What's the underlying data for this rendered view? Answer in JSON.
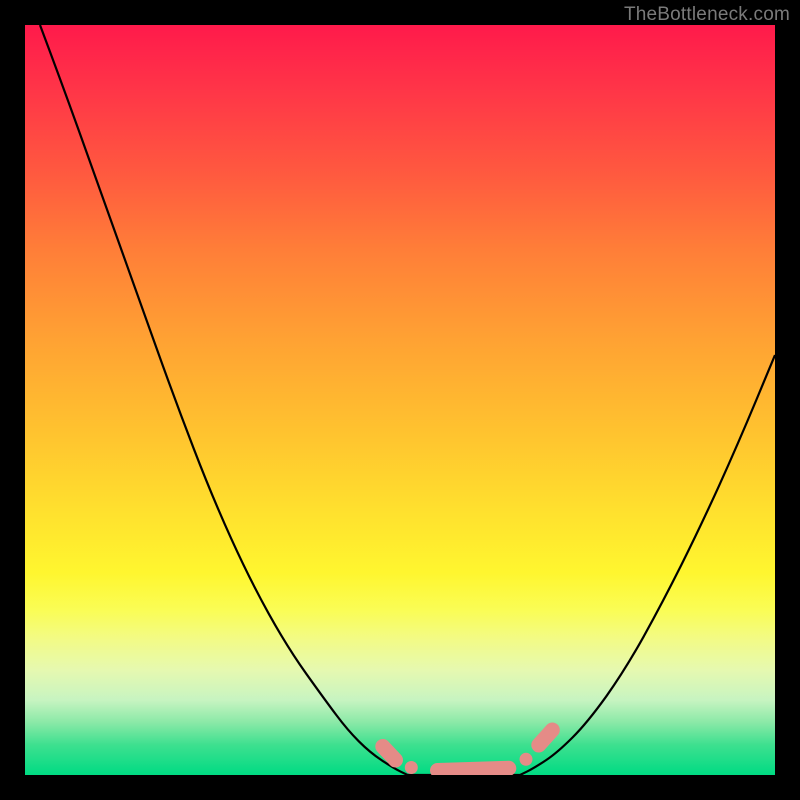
{
  "watermark": "TheBottleneck.com",
  "colors": {
    "frame": "#000000",
    "curve_stroke": "#000000",
    "markers_fill": "#e58b87",
    "gradient_top": "#ff1a4b",
    "gradient_bottom": "#00db83"
  },
  "chart_data": {
    "type": "line",
    "title": "",
    "xlabel": "",
    "ylabel": "",
    "xlim": [
      0,
      100
    ],
    "ylim": [
      0,
      100
    ],
    "grid": false,
    "legend": false,
    "series": [
      {
        "name": "bottleneck-curve-left",
        "x": [
          2,
          5,
          10,
          15,
          20,
          25,
          30,
          35,
          40,
          43,
          46,
          49,
          51
        ],
        "y": [
          100,
          92,
          78,
          64,
          50,
          37,
          26,
          17,
          10,
          6,
          3,
          1,
          0
        ]
      },
      {
        "name": "bottleneck-curve-flat",
        "x": [
          51,
          54,
          57,
          60,
          63,
          66
        ],
        "y": [
          0,
          0,
          0,
          0,
          0,
          0
        ]
      },
      {
        "name": "bottleneck-curve-right",
        "x": [
          66,
          68,
          71,
          75,
          80,
          85,
          90,
          95,
          100
        ],
        "y": [
          0,
          1,
          3,
          7,
          14,
          23,
          33,
          44,
          56
        ]
      }
    ],
    "markers": {
      "name": "highlighted-points",
      "points": [
        {
          "x": 47.7,
          "y": 3.8
        },
        {
          "x": 49.4,
          "y": 2.0
        },
        {
          "x": 51.5,
          "y": 1.0
        },
        {
          "x": 55.0,
          "y": 0.6
        },
        {
          "x": 59.0,
          "y": 0.6
        },
        {
          "x": 62.0,
          "y": 0.6
        },
        {
          "x": 64.5,
          "y": 0.9
        },
        {
          "x": 66.8,
          "y": 2.1
        },
        {
          "x": 68.5,
          "y": 4.0
        },
        {
          "x": 70.3,
          "y": 6.0
        }
      ]
    }
  }
}
